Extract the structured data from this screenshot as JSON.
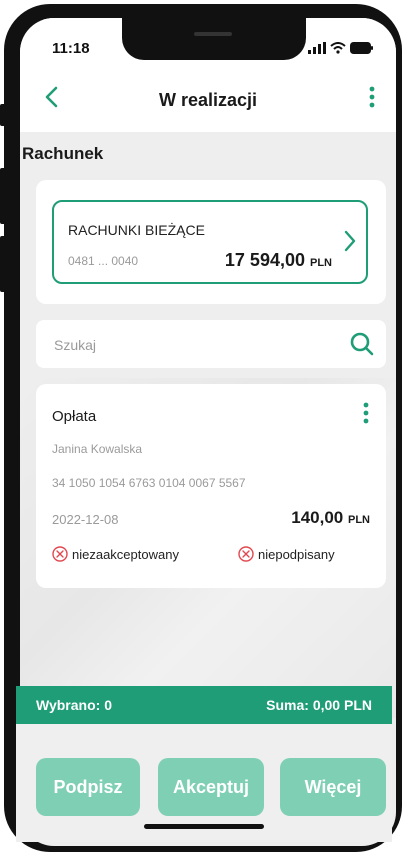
{
  "status_bar": {
    "time": "11:18"
  },
  "header": {
    "title": "W realizacji"
  },
  "section": {
    "label": "Rachunek"
  },
  "account": {
    "name": "RACHUNKI BIEŻĄCE",
    "number": "0481 ... 0040",
    "amount_main": "17 594,00",
    "currency": "PLN"
  },
  "search": {
    "placeholder": "Szukaj"
  },
  "payment": {
    "title": "Opłata",
    "recipient": "Janina Kowalska",
    "account_number": "34 1050 1054 6763 0104 0067 5567",
    "date": "2022-12-08",
    "amount_main": "140,00",
    "currency": "PLN",
    "status_accept": "niezaakceptowany",
    "status_sign": "niepodpisany"
  },
  "summary": {
    "selected": "Wybrano: 0",
    "total": "Suma: 0,00 PLN"
  },
  "actions": {
    "sign": "Podpisz",
    "accept": "Akceptuj",
    "more": "Więcej"
  },
  "colors": {
    "accent": "#1f9d76",
    "button_disabled": "#7fcfb5",
    "error": "#e0484f"
  }
}
